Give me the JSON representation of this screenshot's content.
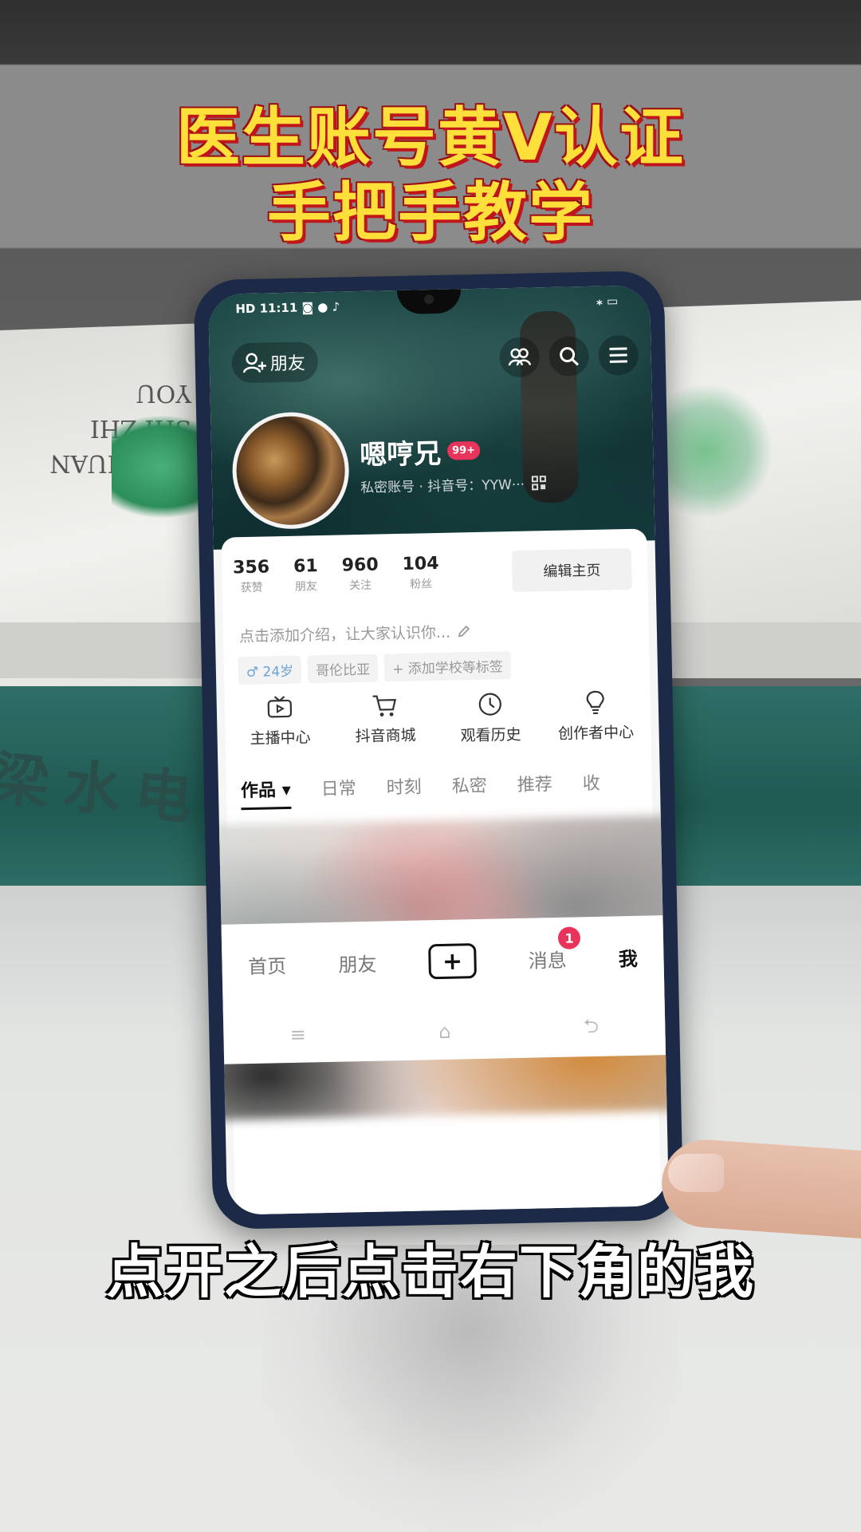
{
  "video": {
    "title_line1": "医生账号黄V认证",
    "title_line2": "手把手教学",
    "subtitle": "点开之后点击右下角的我"
  },
  "background": {
    "book_spine_text": "梁水电",
    "book_cover_text": "YOU HUAN SHI ZHI YOU"
  },
  "status_bar": {
    "left": "HD 11:11 ◙ ● ♪",
    "right": "⁎ ▭"
  },
  "header": {
    "friend_button_label": "朋友",
    "icons": [
      "people-icon",
      "search-icon",
      "menu-icon"
    ]
  },
  "profile": {
    "username": "嗯哼兄",
    "badge": "99+",
    "account_line": "私密账号 · 抖音号：YYW···"
  },
  "stats": [
    {
      "value": "356",
      "label": "获赞"
    },
    {
      "value": "61",
      "label": "朋友"
    },
    {
      "value": "960",
      "label": "关注"
    },
    {
      "value": "104",
      "label": "粉丝"
    }
  ],
  "edit_button": "编辑主页",
  "intro_placeholder": "点击添加介绍，让大家认识你...",
  "tags": {
    "gender_age": "♂ 24岁",
    "location": "哥伦比亚",
    "add_school": "+ 添加学校等标签"
  },
  "shortcuts": [
    {
      "label": "主播中心",
      "icon": "tv-icon"
    },
    {
      "label": "抖音商城",
      "icon": "cart-icon"
    },
    {
      "label": "观看历史",
      "icon": "clock-icon"
    },
    {
      "label": "创作者中心",
      "icon": "bulb-icon"
    }
  ],
  "content_tabs": [
    "作品 ▾",
    "日常",
    "时刻",
    "私密",
    "推荐",
    "收"
  ],
  "bottom_nav": {
    "home": "首页",
    "friends": "朋友",
    "plus": "+",
    "messages": "消息",
    "messages_badge": "1",
    "me": "我"
  },
  "system_nav": [
    "≡",
    "⌂",
    "⮌"
  ]
}
